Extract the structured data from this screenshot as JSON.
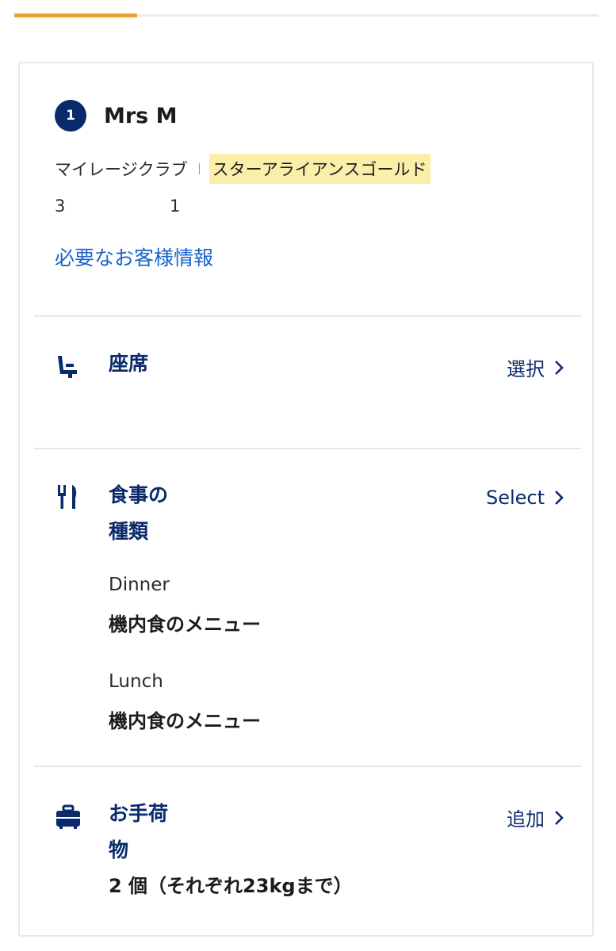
{
  "progress": {
    "fraction": 0.21
  },
  "passenger": {
    "index": "1",
    "name": "Mrs M",
    "program_label": "マイレージクラブ",
    "tier": "スターアライアンスゴールド",
    "number_a": "3",
    "number_b": "1",
    "info_link": "必要なお客様情報"
  },
  "seat": {
    "icon": "seat-icon",
    "title": "座席",
    "action": "選択"
  },
  "meal": {
    "icon": "cutlery-icon",
    "title_line1": "食事の",
    "title_line2": "種類",
    "action": "Select",
    "items": [
      {
        "label": "Dinner",
        "value": "機内食のメニュー"
      },
      {
        "label": "Lunch",
        "value": "機内食のメニュー"
      }
    ]
  },
  "baggage": {
    "icon": "suitcase-icon",
    "title_line1": "お手荷",
    "title_line2": "物",
    "action": "追加",
    "allowance": "2 個（それぞれ23kgまで）"
  },
  "colors": {
    "accent": "#f0a22e",
    "navy": "#0a2a6b",
    "link": "#1a64c8",
    "highlight": "#fbeea8"
  }
}
